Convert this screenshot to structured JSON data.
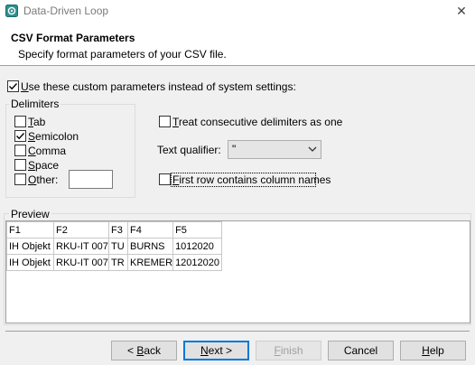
{
  "window": {
    "title": "Data-Driven Loop"
  },
  "header": {
    "title": "CSV Format Parameters",
    "subtitle": "Specify format parameters of your CSV file."
  },
  "use_custom": {
    "prefix": "U",
    "rest": "se these custom parameters instead of system settings:",
    "checked": true
  },
  "delimiters": {
    "title": "Delimiters",
    "tab": {
      "prefix": "T",
      "rest": "ab",
      "checked": false
    },
    "semicolon": {
      "prefix": "S",
      "rest": "emicolon",
      "checked": true
    },
    "comma": {
      "prefix": "C",
      "rest": "omma",
      "checked": false
    },
    "space": {
      "prefix": "S",
      "rest": "pace",
      "checked": false
    },
    "other": {
      "prefix": "O",
      "rest": "ther:",
      "checked": false,
      "value": ""
    }
  },
  "consecutive": {
    "prefix": "T",
    "rest": "reat consecutive delimiters as one",
    "checked": false
  },
  "text_qualifier": {
    "label": "Text qualifier:",
    "value": "\""
  },
  "first_row": {
    "prefix": "F",
    "rest": "irst row contains column names",
    "checked": false
  },
  "preview": {
    "title": "Preview",
    "rows": [
      [
        "F1",
        "F2",
        "F3",
        "F4",
        "F5"
      ],
      [
        "IH Objekt",
        "RKU-IT 007",
        "TU",
        "BURNS",
        "1012020"
      ],
      [
        "IH Objekt",
        "RKU-IT 007",
        "TR",
        "KREMER",
        "12012020"
      ]
    ]
  },
  "buttons": {
    "back": {
      "prefix": "< ",
      "key": "B",
      "rest": "ack"
    },
    "next": {
      "key": "N",
      "rest": "ext >"
    },
    "finish": {
      "key": "F",
      "rest": "inish"
    },
    "cancel": {
      "label": "Cancel"
    },
    "help": {
      "key": "H",
      "rest": "elp"
    }
  }
}
